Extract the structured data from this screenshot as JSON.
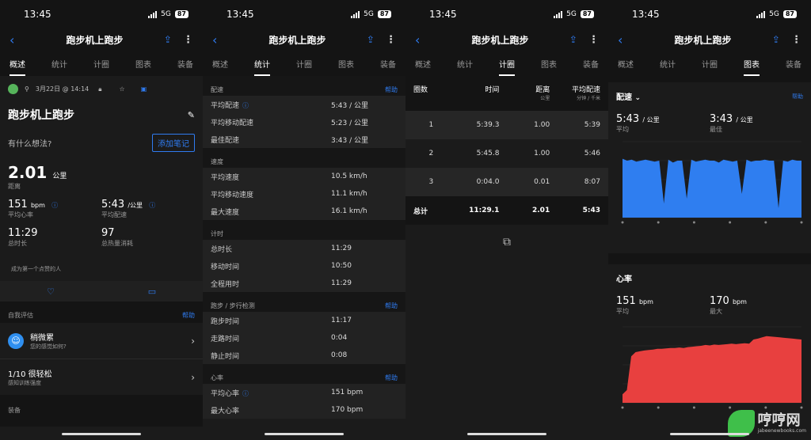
{
  "status": {
    "time": "13:45",
    "network": "5G",
    "battery": "87"
  },
  "nav": {
    "title": "跑步机上跑步"
  },
  "tabs": [
    "概述",
    "统计",
    "计圈",
    "图表",
    "装备"
  ],
  "overview": {
    "date": "3月22日 @ 14:14",
    "activity_title": "跑步机上跑步",
    "note_prompt": "有什么想法?",
    "add_note": "添加笔记",
    "distance": {
      "value": "2.01",
      "unit": "公里",
      "label": "距离"
    },
    "hr": {
      "value": "151",
      "unit": "bpm",
      "label": "平均心率"
    },
    "pace": {
      "value": "5:43",
      "unit": "/公里",
      "label": "平均配速"
    },
    "duration": {
      "value": "11:29",
      "label": "总时长"
    },
    "calories": {
      "value": "97",
      "label": "总热量消耗"
    },
    "kudos": "成为第一个点赞的人",
    "self_eval": "自我评估",
    "help": "帮助",
    "feel": {
      "title": "稍微累",
      "subtitle": "您的感觉如何?"
    },
    "effort": {
      "title": "1/10 很轻松",
      "subtitle": "感知训练强度"
    },
    "gear_section": "装备"
  },
  "stats": {
    "help": "帮助",
    "sections": [
      {
        "title": "配速",
        "help": true,
        "rows": [
          {
            "label": "平均配速",
            "value": "5:43 / 公里",
            "info": true
          },
          {
            "label": "平均移动配速",
            "value": "5:23 / 公里"
          },
          {
            "label": "最佳配速",
            "value": "3:43 / 公里"
          }
        ]
      },
      {
        "title": "速度",
        "help": false,
        "rows": [
          {
            "label": "平均速度",
            "value": "10.5 km/h"
          },
          {
            "label": "平均移动速度",
            "value": "11.1 km/h"
          },
          {
            "label": "最大速度",
            "value": "16.1 km/h"
          }
        ]
      },
      {
        "title": "计时",
        "help": false,
        "rows": [
          {
            "label": "总时长",
            "value": "11:29"
          },
          {
            "label": "移动时间",
            "value": "10:50"
          },
          {
            "label": "全程用时",
            "value": "11:29"
          }
        ]
      },
      {
        "title": "跑步 / 步行检测",
        "help": true,
        "rows": [
          {
            "label": "跑步时间",
            "value": "11:17"
          },
          {
            "label": "走路时间",
            "value": "0:04"
          },
          {
            "label": "静止时间",
            "value": "0:08"
          }
        ]
      },
      {
        "title": "心率",
        "help": true,
        "rows": [
          {
            "label": "平均心率",
            "value": "151 bpm",
            "info": true
          },
          {
            "label": "最大心率",
            "value": "170 bpm"
          }
        ]
      }
    ]
  },
  "laps": {
    "headers": [
      {
        "t": "圈数"
      },
      {
        "t": "时间"
      },
      {
        "t": "距离",
        "s": "公里"
      },
      {
        "t": "平均配速",
        "s": "分钟 / 千米"
      }
    ],
    "rows": [
      [
        "1",
        "5:39.3",
        "1.00",
        "5:39"
      ],
      [
        "2",
        "5:45.8",
        "1.00",
        "5:46"
      ],
      [
        "3",
        "0:04.0",
        "0.01",
        "8:07"
      ]
    ],
    "total": [
      "总计",
      "11:29.1",
      "2.01",
      "5:43"
    ]
  },
  "charts": {
    "pace": {
      "title": "配速",
      "help": "帮助",
      "avg": "5:43",
      "unit": "/ 公里",
      "avg_label": "平均",
      "best": "3:43",
      "best_label": "最佳"
    },
    "hr": {
      "title": "心率",
      "avg": "151",
      "unit": "bpm",
      "avg_label": "平均",
      "max": "170",
      "max_label": "最大"
    }
  },
  "chart_data": [
    {
      "type": "area",
      "title": "配速",
      "color": "#2f7ef0",
      "values": [
        6.2,
        6.0,
        6.1,
        5.9,
        6.0,
        6.1,
        6.0,
        5.9,
        6.0,
        1.5,
        6.1,
        5.8,
        6.0,
        6.0,
        2.0,
        6.1,
        5.9,
        6.0,
        6.1,
        6.0,
        6.0,
        5.8,
        6.1,
        6.0,
        5.9,
        6.0,
        2.5,
        6.1,
        5.9,
        6.0,
        6.0,
        6.1,
        6.0,
        6.0,
        1.0,
        6.0,
        5.9,
        6.1,
        6.0,
        6.0
      ],
      "ylim": [
        0,
        8
      ]
    },
    {
      "type": "area",
      "title": "心率",
      "color": "#e8403f",
      "values": [
        20,
        30,
        110,
        120,
        122,
        124,
        125,
        126,
        128,
        128,
        129,
        130,
        130,
        131,
        130,
        132,
        133,
        134,
        135,
        137,
        136,
        138,
        137,
        138,
        139,
        140,
        139,
        140,
        141,
        140,
        150,
        152,
        155,
        158,
        157,
        156,
        155,
        154,
        153,
        152,
        151,
        150
      ],
      "ylim": [
        0,
        180
      ]
    }
  ]
}
